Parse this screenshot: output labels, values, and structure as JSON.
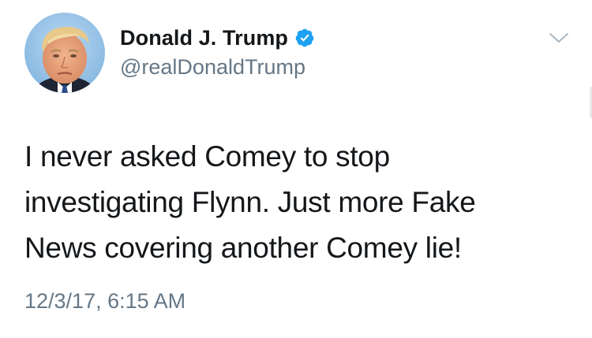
{
  "tweet": {
    "display_name": "Donald J. Trump",
    "handle": "@realDonaldTrump",
    "verified": true,
    "text_lines": [
      "I never asked Comey to stop",
      "investigating Flynn. Just more Fake",
      "News covering another Comey lie!"
    ],
    "timestamp": "12/3/17, 6:15 AM"
  },
  "icons": {
    "verified": "verified-badge-icon",
    "caret": "chevron-down-icon"
  },
  "colors": {
    "text_primary": "#14171a",
    "text_secondary": "#657786",
    "verified_blue": "#1da1f2",
    "avatar_background": "#8fc0e8"
  }
}
